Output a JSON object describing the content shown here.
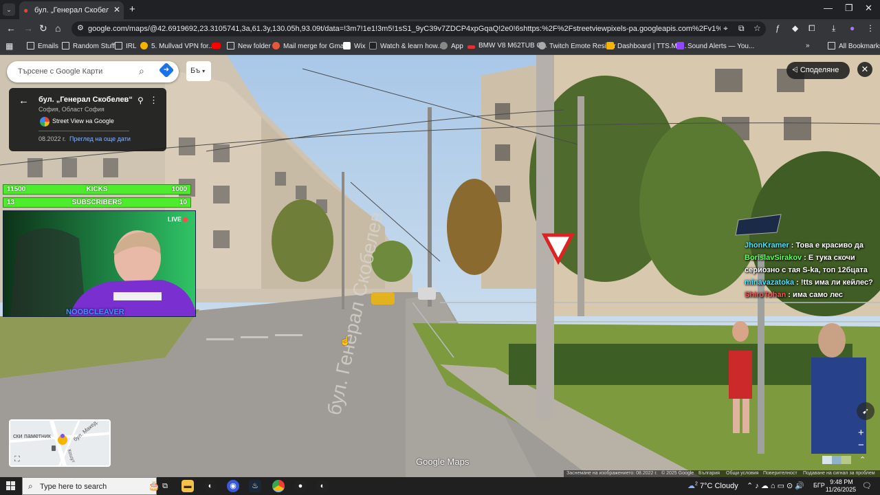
{
  "browser": {
    "tab_title": "бул. „Генерал Скобелев“ – Goo",
    "url": "google.com/maps/@42.6919692,23.3105741,3a,61.3y,130.05h,93.09t/data=!3m7!1e1!3m5!1sS1_9yC39v7ZDCP4xpGqaQ!2e0!6shttps:%2F%2Fstreetviewpixels-pa.googleapis.com%2Fv1%2Fthumbnail%3Fcb_client%3Dmaps...",
    "bookmarks": [
      {
        "label": "Emails",
        "icon": "folder-icon",
        "color": "#dddddd"
      },
      {
        "label": "Random Stuff",
        "icon": "folder-icon",
        "color": "#dddddd"
      },
      {
        "label": "IRL",
        "icon": "folder-icon",
        "color": "#dddddd"
      },
      {
        "label": "5. Mullvad VPN for...",
        "icon": "mullvad-icon",
        "color": "#f5b400"
      },
      {
        "label": "",
        "icon": "youtube-icon",
        "color": "#ff0000"
      },
      {
        "label": "New folder",
        "icon": "folder-icon",
        "color": "#dddddd"
      },
      {
        "label": "Mail merge for Gma...",
        "icon": "mailmerge-icon",
        "color": "#e5583b"
      },
      {
        "label": "Wix",
        "icon": "wix-icon",
        "color": "#ffffff"
      },
      {
        "label": "Watch & learn how...",
        "icon": "watch-icon",
        "color": "#444444"
      },
      {
        "label": "App",
        "icon": "app-icon",
        "color": "#888888"
      },
      {
        "label": "BMW V8 M62TUB C...",
        "icon": "bmw-icon",
        "color": "#d33"
      },
      {
        "label": "Twitch Emote Resizer",
        "icon": "twitch-icon",
        "color": "#aaaaaa"
      },
      {
        "label": "Dashboard | TTS.Mo...",
        "icon": "dashboard-icon",
        "color": "#f5b400"
      },
      {
        "label": "Sound Alerts — You...",
        "icon": "soundalerts-icon",
        "color": "#9146ff"
      }
    ],
    "all_bookmarks": "All Bookmarks"
  },
  "maps": {
    "search_placeholder": "Търсене с Google Карти",
    "lang_button": "Бъ",
    "place_title": "бул. „Генерал Скобелев“",
    "place_subtitle": "София, Област София",
    "street_view_label": "Street View на Google",
    "date": "08.2022 г.",
    "more_dates": "Преглед на още дати",
    "share": "Споделяне",
    "minimap_labels": [
      "ски паметник",
      "бул. Макед.",
      "Кошут"
    ],
    "logo": "Google Maps",
    "footer": [
      "Заснемане на изображението: 08.2022 г.",
      "© 2025 Google",
      "България",
      "Общи условия",
      "Поверителност",
      "Подаване на сигнал за проблем"
    ],
    "street_text": "бул. Генерал Скобелев"
  },
  "stream": {
    "kicks": {
      "left": "11500",
      "label": "KICKS",
      "right": "1000"
    },
    "subscribers": {
      "left": "13",
      "label": "SUBSCRIBERS",
      "right": "10"
    },
    "live": "LIVE",
    "streamer": "NOOBCLEAVER",
    "chat": [
      {
        "user": "JhonKramer",
        "color": "#4ee0ff",
        "text": ": Това е красиво да"
      },
      {
        "user": "BorislavSirakov",
        "color": "#61ff5c",
        "text": ": Е тука скочи сериозно с тая S-ka, топ 12бцата"
      },
      {
        "user": "minavazatoka",
        "color": "#4ee0ff",
        "text": ": !tts има ли кейлес?"
      },
      {
        "user": "ShiroTohan",
        "color": "#ff4d4d",
        "text": ": има само лес"
      }
    ]
  },
  "taskbar": {
    "search_placeholder": "Type here to search",
    "weather": "7°C  Cloudy",
    "weather_badge": "2",
    "lang": "БГР",
    "time": "9:48 PM",
    "date": "11/26/2025"
  }
}
